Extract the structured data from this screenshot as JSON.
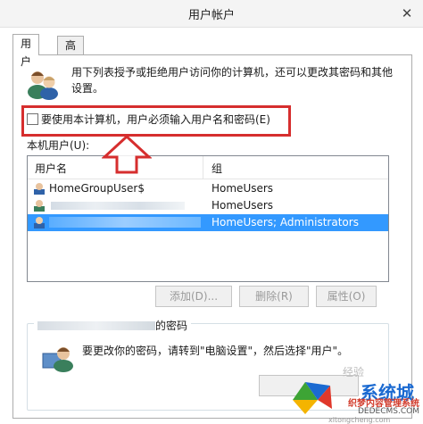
{
  "window": {
    "title": "用户帐户",
    "close_label": "✕"
  },
  "tabs": [
    {
      "label": "用户"
    },
    {
      "label": "高级"
    }
  ],
  "description": "用下列表授予或拒绝用户访问你的计算机，还可以更改其密码和其他设置。",
  "checkbox": {
    "label": "要使用本计算机，用户必须输入用户名和密码(E)",
    "checked": false
  },
  "local_users_label": "本机用户(U):",
  "table": {
    "columns": [
      "用户名",
      "组"
    ],
    "rows": [
      {
        "name": "HomeGroupUser$",
        "group": "HomeUsers",
        "selected": false
      },
      {
        "name": "",
        "group": "HomeUsers",
        "selected": false
      },
      {
        "name": "",
        "group": "HomeUsers; Administrators",
        "selected": true
      }
    ]
  },
  "buttons": {
    "add": "添加(D)...",
    "remove": "删除(R)",
    "properties": "属性(O)"
  },
  "password_group": {
    "title_suffix": "的密码",
    "text": "要更改你的密码，请转到\"电脑设置\"，然后选择\"用户\"。"
  },
  "watermarks": {
    "brand": "系统城",
    "cn": "织梦内容管理系统",
    "url": "DEDECMS.COM",
    "site": "xitongcheng.com",
    "baidu": "经验"
  },
  "colors": {
    "highlight": "#d62e2e",
    "selection": "#3399ff"
  }
}
